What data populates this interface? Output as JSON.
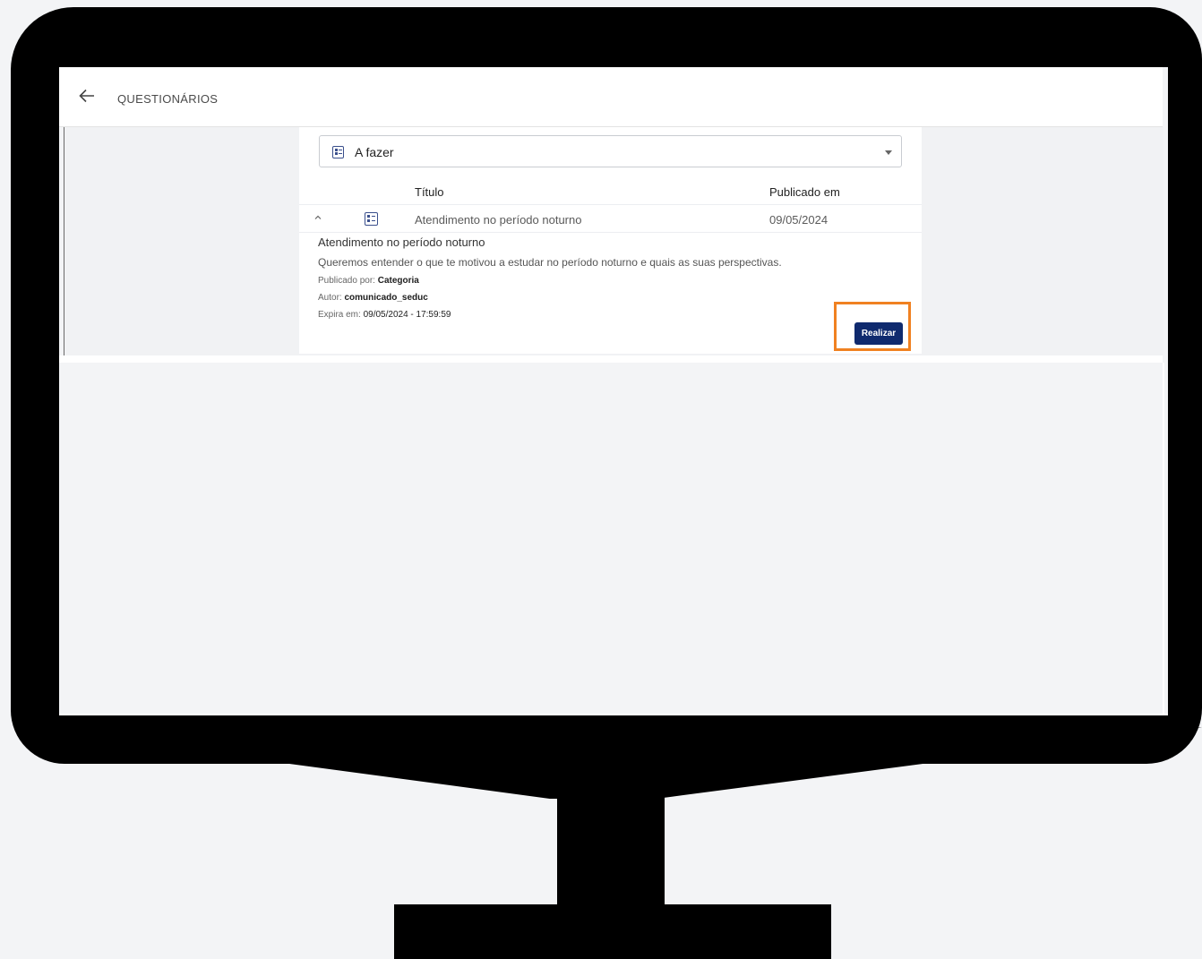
{
  "header": {
    "back_icon": "arrow-left-icon",
    "title": "QUESTIONÁRIOS"
  },
  "filter": {
    "icon": "list-icon",
    "selected": "A fazer"
  },
  "table": {
    "columns": [
      "Título",
      "Publicado em"
    ],
    "rows": [
      {
        "expand_icon": "chevron-up-icon",
        "type_icon": "list-icon",
        "title": "Atendimento no período noturno",
        "published": "09/05/2024"
      }
    ]
  },
  "details": {
    "title": "Atendimento no período noturno",
    "description": "Queremos entender o que te motivou a estudar no período noturno e quais as suas perspectivas.",
    "published_by_label": "Publicado por:",
    "published_by_value": "Categoria",
    "author_label": "Autor:",
    "author_value": "comunicado_seduc",
    "expires_label": "Expira em:",
    "expires_value": "09/05/2024 - 17:59:59",
    "action_label": "Realizar"
  },
  "colors": {
    "primary": "#0f2a6e",
    "highlight": "#f08121",
    "icon": "#3a4f8c"
  }
}
